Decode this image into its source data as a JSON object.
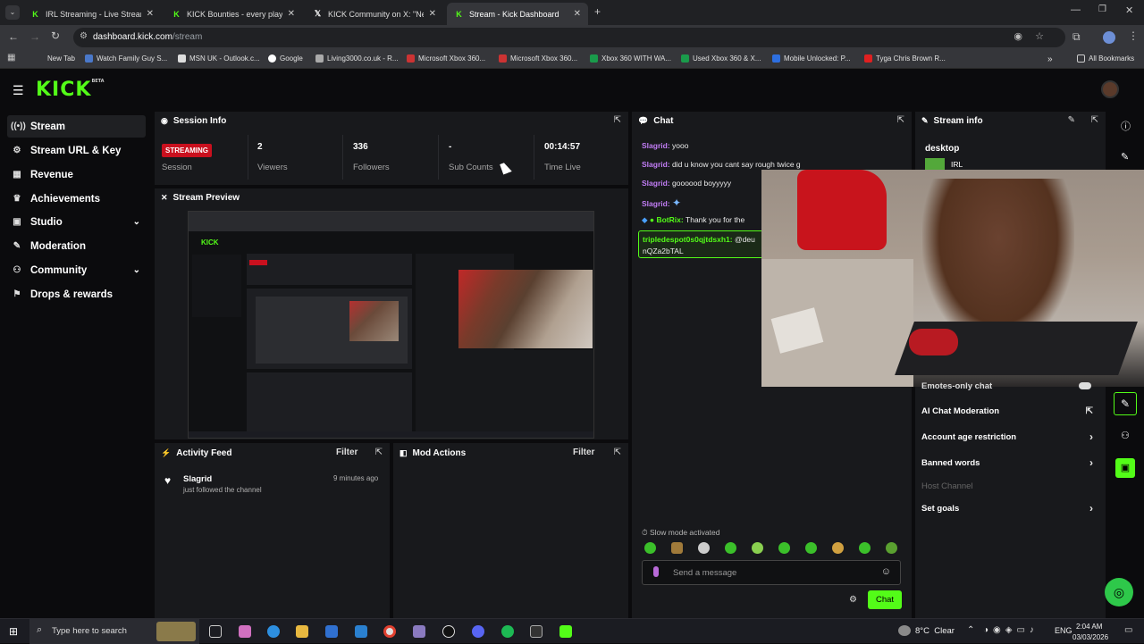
{
  "browser": {
    "tabs": [
      {
        "title": "IRL Streaming - Live Streams on",
        "icon": "kick-favicon",
        "active": false
      },
      {
        "title": "KICK Bounties - every player for",
        "icon": "kick-favicon",
        "active": false
      },
      {
        "title": "KICK Community on X: \"New B",
        "icon": "x-favicon",
        "active": false
      },
      {
        "title": "Stream - Kick Dashboard",
        "icon": "kick-favicon",
        "active": true
      }
    ],
    "url_host": "dashboard.kick.com",
    "url_path": "/stream",
    "bookmarks": [
      "New Tab",
      "Watch Family Guy S...",
      "MSN UK - Outlook.c...",
      "Google",
      "Living3000.co.uk - R...",
      "Microsoft Xbox 360...",
      "Microsoft Xbox 360...",
      "Xbox 360 WITH WA...",
      "Used Xbox 360 & X...",
      "Mobile Unlocked: P...",
      "Tyga Chris Brown R..."
    ],
    "all_bookmarks": "All Bookmarks",
    "colors": {
      "tab_bg": "#202124",
      "toolbar": "#35363a"
    }
  },
  "app": {
    "logo": "KICK",
    "logo_sup": "BETA",
    "accent": "#53fc18",
    "sidebar": [
      {
        "label": "Stream",
        "icon": "stream-icon",
        "active": true,
        "chevron": false
      },
      {
        "label": "Stream URL & Key",
        "icon": "gear-icon",
        "active": false,
        "chevron": false
      },
      {
        "label": "Revenue",
        "icon": "revenue-icon",
        "active": false,
        "chevron": false
      },
      {
        "label": "Achievements",
        "icon": "trophy-icon",
        "active": false,
        "chevron": false
      },
      {
        "label": "Studio",
        "icon": "studio-icon",
        "active": false,
        "chevron": true
      },
      {
        "label": "Moderation",
        "icon": "wrench-icon",
        "active": false,
        "chevron": false
      },
      {
        "label": "Community",
        "icon": "community-icon",
        "active": false,
        "chevron": true
      },
      {
        "label": "Drops & rewards",
        "icon": "gift-icon",
        "active": false,
        "chevron": false
      }
    ],
    "session": {
      "title": "Session Info",
      "badge": "STREAMING",
      "stats": [
        {
          "value": "",
          "label": "Session"
        },
        {
          "value": "2",
          "label": "Viewers"
        },
        {
          "value": "336",
          "label": "Followers"
        },
        {
          "value": "-",
          "label": "Sub Counts"
        },
        {
          "value": "00:14:57",
          "label": "Time Live"
        }
      ]
    },
    "preview": {
      "title": "Stream Preview"
    },
    "activity": {
      "title": "Activity Feed",
      "filter": "Filter",
      "items": [
        {
          "user": "Slagrid",
          "text": "just followed the channel",
          "time": "9 minutes ago"
        }
      ]
    },
    "mod_actions": {
      "title": "Mod Actions",
      "filter": "Filter"
    },
    "chat": {
      "title": "Chat",
      "messages": [
        {
          "user": "Slagrid",
          "text": "yooo"
        },
        {
          "user": "Slagrid",
          "text": "did u know you cant say rough twice g"
        },
        {
          "user": "Slagrid",
          "text": "goooood boyyyyy"
        },
        {
          "user": "Slagrid",
          "text": ""
        },
        {
          "user": "BotRix",
          "text": "Thank you for the"
        }
      ],
      "highlight_user": "tripledespot0s0qjtdsxh1",
      "highlight_text": "@deu",
      "highlight_line2": "nQZa2bTAL",
      "slow_mode": "Slow mode activated",
      "placeholder": "Send a message",
      "send": "Chat"
    },
    "stream_info": {
      "title": "Stream info",
      "category_label": "desktop",
      "category": "IRL",
      "rows": [
        {
          "label": "Emotes-only chat",
          "arrow": "toggle"
        },
        {
          "label": "AI Chat Moderation",
          "arrow": "external"
        },
        {
          "label": "Account age restriction",
          "arrow": "chevron"
        },
        {
          "label": "Banned words",
          "arrow": "chevron"
        },
        {
          "label": "Host Channel",
          "arrow": "none"
        },
        {
          "label": "Set goals",
          "arrow": "chevron"
        }
      ]
    }
  },
  "taskbar": {
    "search": "Type here to search",
    "weather": "8°C  Clear",
    "lang": "ENG",
    "time": "2:04 AM",
    "date": "03/03/2026"
  }
}
